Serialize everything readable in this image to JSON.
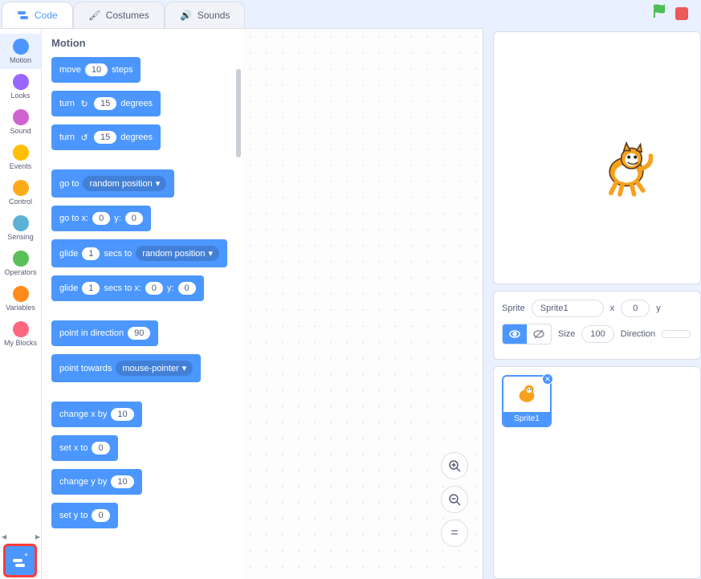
{
  "tabs": {
    "code": "Code",
    "costumes": "Costumes",
    "sounds": "Sounds"
  },
  "categories": [
    {
      "name": "Motion",
      "color": "#4c97ff"
    },
    {
      "name": "Looks",
      "color": "#9966ff"
    },
    {
      "name": "Sound",
      "color": "#cf63cf"
    },
    {
      "name": "Events",
      "color": "#ffbf00"
    },
    {
      "name": "Control",
      "color": "#ffab19"
    },
    {
      "name": "Sensing",
      "color": "#5cb1d6"
    },
    {
      "name": "Operators",
      "color": "#59c059"
    },
    {
      "name": "Variables",
      "color": "#ff8c1a"
    },
    {
      "name": "My Blocks",
      "color": "#ff6680"
    }
  ],
  "palette": {
    "heading": "Motion",
    "blocks": {
      "move": {
        "pre": "move",
        "val": "10",
        "post": "steps"
      },
      "turn_cw": {
        "pre": "turn",
        "val": "15",
        "post": "degrees"
      },
      "turn_ccw": {
        "pre": "turn",
        "val": "15",
        "post": "degrees"
      },
      "goto": {
        "pre": "go to",
        "dd": "random position"
      },
      "gotoxy": {
        "pre": "go to x:",
        "x": "0",
        "mid": "y:",
        "y": "0"
      },
      "glide_rand": {
        "pre": "glide",
        "secs": "1",
        "mid": "secs to",
        "dd": "random position"
      },
      "glide_xy": {
        "pre": "glide",
        "secs": "1",
        "mid": "secs to x:",
        "x": "0",
        "mid2": "y:",
        "y": "0"
      },
      "point_dir": {
        "pre": "point in direction",
        "val": "90"
      },
      "point_towards": {
        "pre": "point towards",
        "dd": "mouse-pointer"
      },
      "change_x": {
        "pre": "change x by",
        "val": "10"
      },
      "set_x": {
        "pre": "set x to",
        "val": "0"
      },
      "change_y": {
        "pre": "change y by",
        "val": "10"
      },
      "set_y": {
        "pre": "set y to",
        "val": "0"
      }
    }
  },
  "sprite_info": {
    "label_sprite": "Sprite",
    "name": "Sprite1",
    "label_x": "x",
    "x": "0",
    "label_y": "y",
    "label_size": "Size",
    "size": "100",
    "label_direction": "Direction"
  },
  "sprite_list": {
    "thumb_label": "Sprite1"
  }
}
